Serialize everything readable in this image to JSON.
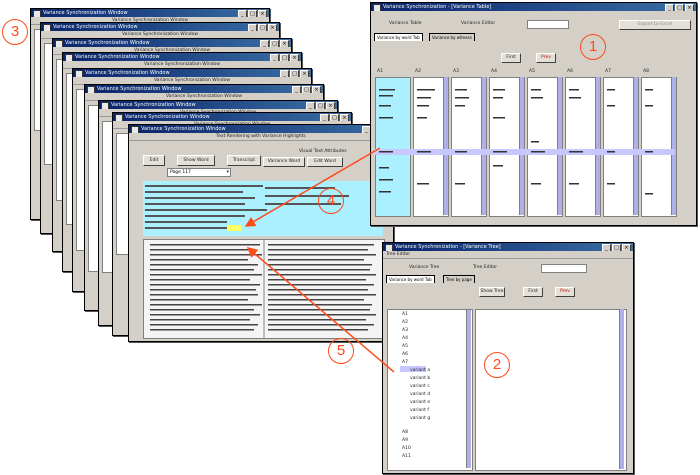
{
  "callouts": {
    "c1": "1",
    "c2": "2",
    "c3": "3",
    "c4": "4",
    "c5": "5"
  },
  "stack": {
    "titles": [
      "Variance Synchronization Window",
      "Variance Synchronization Window",
      "Variance Synchronization Window",
      "Variance Synchronization Window",
      "Variance Synchronization Window",
      "Variance Synchronization Window",
      "Variance Synchronization Window",
      "Variance Synchronization Window"
    ],
    "front": {
      "caption": "Text Rendering with Variance Highlights",
      "buttons": [
        "Edit",
        "Show Word",
        "Transcript"
      ],
      "option_label": "Visual Text Attributes",
      "option_buttons": [
        "Variance Word",
        "Edit Word"
      ],
      "select_value": "Page 117"
    }
  },
  "table_win": {
    "title": "Variance Synchronization - [Variance Table]",
    "toolbar_label_1": "Variance Table",
    "toolbar_label_2": "Variance Editor",
    "toolbar_button": "Export to Excel",
    "tabs": [
      "Variance by word Tab",
      "Variance by witness"
    ],
    "buttons": [
      "First",
      "Prev"
    ],
    "column_heads": [
      "A1",
      "A2",
      "A3",
      "A4",
      "A5",
      "A6",
      "A7",
      "A8"
    ]
  },
  "tree_win": {
    "title": "Variance Synchronization - [Variance Tree]",
    "toolbar_label_1": "Variance Tree",
    "toolbar_label_2": "Tree Editor",
    "tabs": [
      "Variance by word Tab",
      "Tree by page"
    ],
    "buttons": [
      "Show Tree",
      "First",
      "Prev"
    ],
    "tree_items": [
      "A1",
      "A2",
      "A3",
      "A4",
      "A5",
      "A6",
      "A7",
      "variant a",
      "variant b",
      "variant c",
      "variant d",
      "variant e",
      "variant f",
      "variant g",
      "A8",
      "A9",
      "A10",
      "A11"
    ]
  }
}
